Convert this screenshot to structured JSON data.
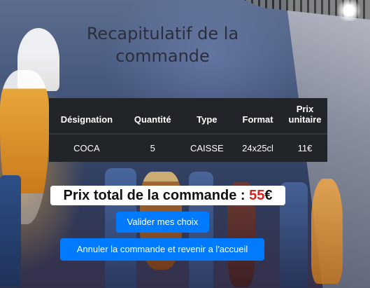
{
  "page": {
    "title": "Recapitulatif de la commande"
  },
  "table": {
    "headers": [
      "Désignation",
      "Quantité",
      "Type",
      "Format",
      "Prix unitaire"
    ],
    "rows": [
      [
        "COCA",
        "5",
        "CAISSE",
        "24x25cl",
        "11€"
      ]
    ]
  },
  "total": {
    "label": "Prix total de la commande : ",
    "amount": "55",
    "currency": "€"
  },
  "buttons": {
    "validate": "Valider mes choix",
    "cancel": "Annuler la commande et revenir a l'accueil"
  },
  "colors": {
    "button_blue": "#007bff",
    "table_dark": "#212529",
    "total_amount_red": "#dc1f1f"
  }
}
